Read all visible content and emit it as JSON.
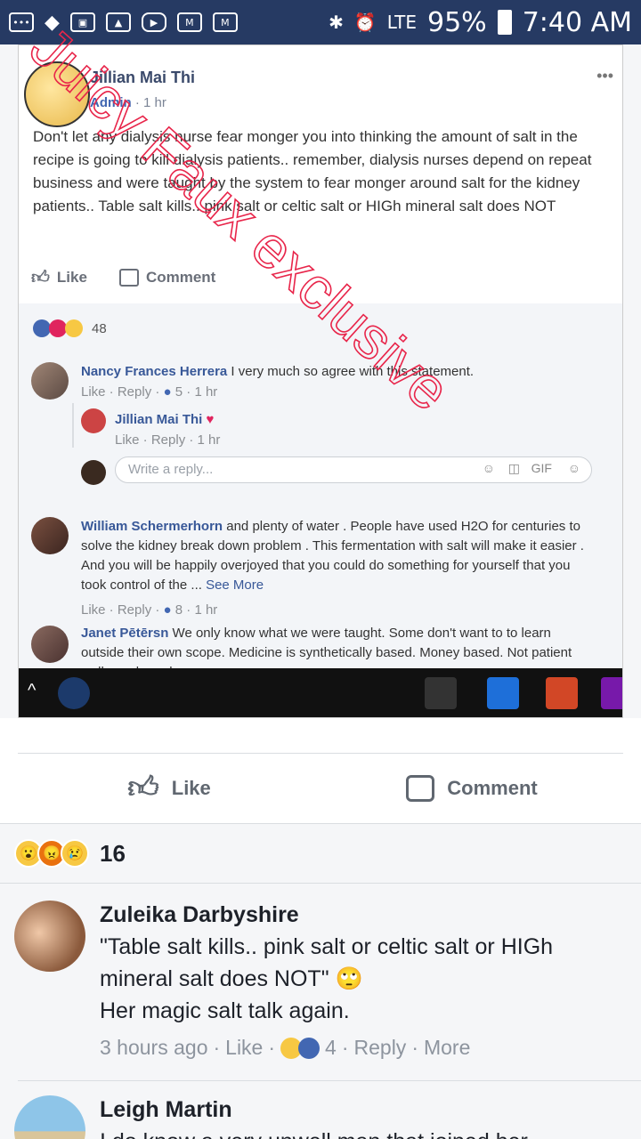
{
  "statusbar": {
    "battery": "95%",
    "time": "7:40 AM",
    "network": "LTE"
  },
  "embedded_post": {
    "poster_name": "Jillian Mai Thi",
    "poster_role": "Admin",
    "poster_time": "· 1 hr",
    "body": "Don't let any dialysis nurse fear monger you into thinking the amount of salt in the recipe is going to kill dialysis patients.. remember, dialysis nurses depend on repeat business and were taught by the system to fear monger around salt for the kidney patients.. Table salt kills.. pink salt or celtic salt or HIGh mineral salt does NOT",
    "like_label": "Like",
    "comment_label": "Comment",
    "reaction_count": "48",
    "comments": [
      {
        "name": "Nancy Frances Herrera",
        "text": " I very much so agree with this statement.",
        "meta": "Like · Reply · ",
        "reacts": "5",
        "time": " · 1 hr"
      },
      {
        "name": "Jillian Mai Thi",
        "text": "",
        "meta": "Like · Reply · 1 hr"
      },
      {
        "name": "William Schermerhorn",
        "text": " and plenty of water . People have used H2O for centuries to solve the kidney break down problem . This fermentation with salt will make it easier . And you will be happily overjoyed that you could do something for yourself that you took control of the ... ",
        "see_more": "See More",
        "meta": "Like · Reply · ",
        "reacts": "8",
        "time": " · 1 hr"
      },
      {
        "name": "Janet Pētērsn",
        "text": " We only know what we were taught. Some don't want to to learn outside their own scope. Medicine is synthetically based. Money based. Not patient wellness based."
      }
    ],
    "reply_placeholder": "Write a reply..."
  },
  "watermark": "Juicy Faux exclusive",
  "actions": {
    "like": "Like",
    "comment": "Comment"
  },
  "reactions": {
    "count": "16"
  },
  "comments": [
    {
      "name": "Zuleika Darbyshire",
      "text1": "\"Table salt kills.. pink salt or celtic salt or HIGh mineral salt does NOT\" 🙄",
      "text2": "Her magic salt talk again.",
      "time": "3 hours ago",
      "like": "Like",
      "reacts": "4",
      "reply": "Reply",
      "more": "More"
    },
    {
      "name": "Leigh Martin",
      "text1": "I do know a very unwell man that joined her"
    }
  ],
  "colors": {
    "statusbar": "#263a63",
    "fb_blue": "#4267b2",
    "watermark": "#e8254a"
  }
}
